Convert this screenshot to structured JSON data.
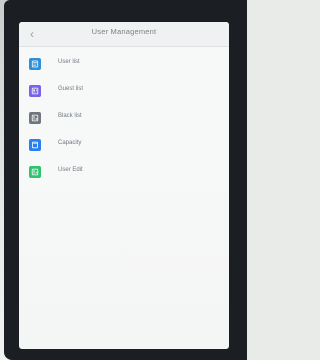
{
  "header": {
    "back_icon": "chevron-left-icon",
    "title": "User Management"
  },
  "menu": {
    "items": [
      {
        "label": "User list",
        "icon": "user-list-icon",
        "color": "#2d8fd8"
      },
      {
        "label": "Guest list",
        "icon": "guest-list-icon",
        "color": "#7b63e6"
      },
      {
        "label": "Black list",
        "icon": "black-list-icon",
        "color": "#6f767d"
      },
      {
        "label": "Capacity",
        "icon": "capacity-icon",
        "color": "#2a7ff0"
      },
      {
        "label": "User Edit",
        "icon": "user-edit-icon",
        "color": "#30c36e"
      }
    ]
  },
  "colors": {
    "background": "#f7f8f8",
    "header": "#f0f1f2",
    "text": "#707a80"
  }
}
